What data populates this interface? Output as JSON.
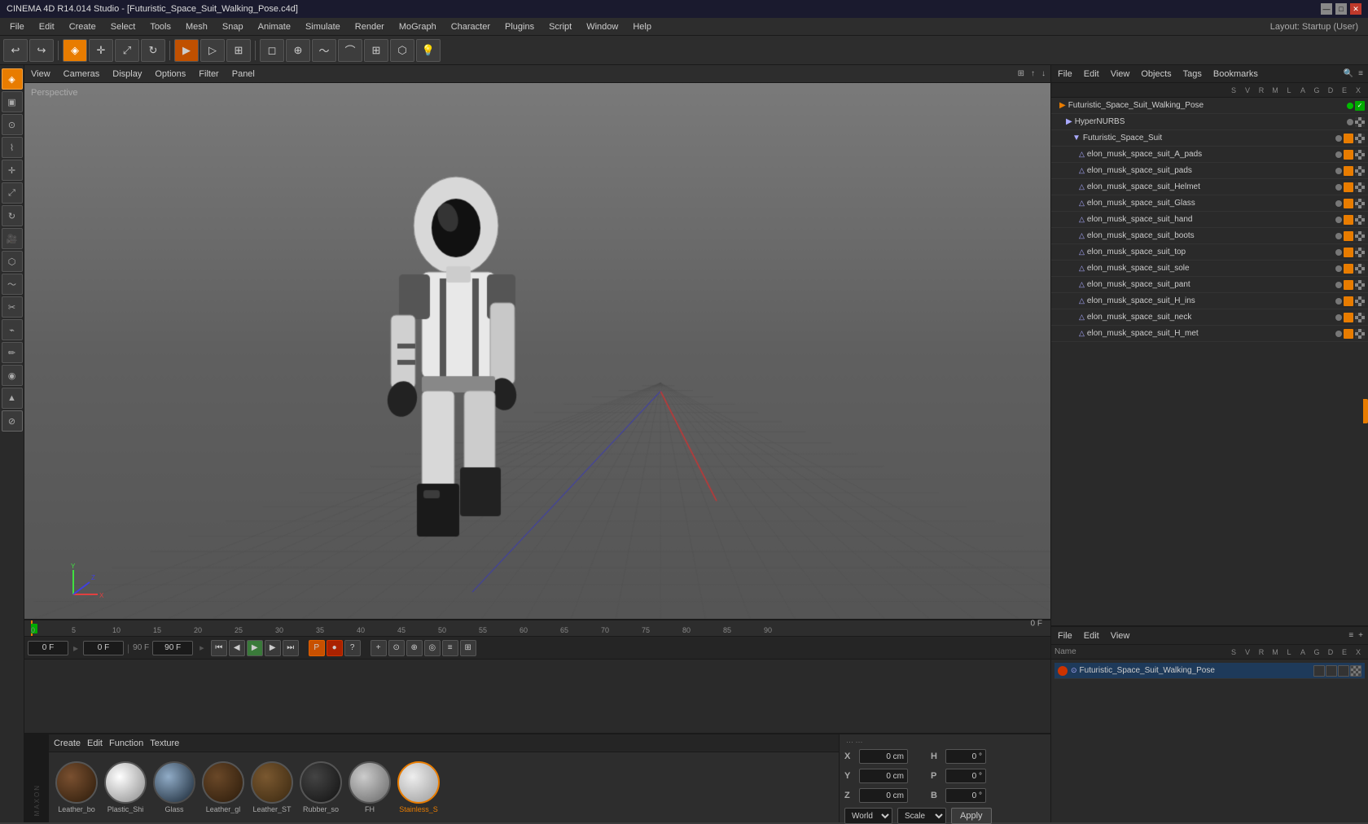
{
  "titleBar": {
    "title": "CINEMA 4D R14.014 Studio - [Futuristic_Space_Suit_Walking_Pose.c4d]",
    "minBtn": "—",
    "maxBtn": "□",
    "closeBtn": "✕"
  },
  "menuBar": {
    "items": [
      "File",
      "Edit",
      "Create",
      "Select",
      "Tools",
      "Mesh",
      "Snap",
      "Animate",
      "Simulate",
      "Render",
      "MoGraph",
      "Character",
      "Plugins",
      "Script",
      "Window",
      "Help"
    ],
    "layoutLabel": "Layout: Startup (User)"
  },
  "viewport": {
    "label": "Perspective",
    "viewMenu": [
      "View",
      "Cameras",
      "Display",
      "Options",
      "Filter",
      "Panel"
    ]
  },
  "objectManager": {
    "topMenus": [
      "File",
      "Edit",
      "View",
      "Objects",
      "Tags",
      "Bookmarks"
    ],
    "topObject": "Futuristic_Space_Suit_Walking_Pose",
    "objects": [
      {
        "name": "HyperNURBS",
        "indent": 1,
        "type": "nurbs"
      },
      {
        "name": "Futuristic_Space_Suit",
        "indent": 2,
        "type": "null"
      },
      {
        "name": "elon_musk_space_suit_A_pads",
        "indent": 3,
        "type": "poly"
      },
      {
        "name": "elon_musk_space_suit_pads",
        "indent": 3,
        "type": "poly"
      },
      {
        "name": "elon_musk_space_suit_Helmet",
        "indent": 3,
        "type": "poly"
      },
      {
        "name": "elon_musk_space_suit_Glass",
        "indent": 3,
        "type": "poly"
      },
      {
        "name": "elon_musk_space_suit_hand",
        "indent": 3,
        "type": "poly"
      },
      {
        "name": "elon_musk_space_suit_boots",
        "indent": 3,
        "type": "poly"
      },
      {
        "name": "elon_musk_space_suit_top",
        "indent": 3,
        "type": "poly"
      },
      {
        "name": "elon_musk_space_suit_sole",
        "indent": 3,
        "type": "poly"
      },
      {
        "name": "elon_musk_space_suit_pant",
        "indent": 3,
        "type": "poly"
      },
      {
        "name": "elon_musk_space_suit_H_ins",
        "indent": 3,
        "type": "poly"
      },
      {
        "name": "elon_musk_space_suit_neck",
        "indent": 3,
        "type": "poly"
      },
      {
        "name": "elon_musk_space_suit_H_met",
        "indent": 3,
        "type": "poly"
      }
    ],
    "bottomMenus": [
      "File",
      "Edit",
      "View"
    ],
    "bottomObject": "Futuristic_Space_Suit_Walking_Pose",
    "colHeaders": [
      "S",
      "V",
      "R",
      "M",
      "L",
      "A",
      "G",
      "D",
      "E",
      "X"
    ]
  },
  "timeline": {
    "startFrame": "0 F",
    "endFrame": "90 F",
    "currentFrame": "0 F",
    "currentFrameInput": "0 F",
    "frameRangeEnd": "90 F",
    "ticks": [
      "0",
      "5",
      "10",
      "15",
      "20",
      "25",
      "30",
      "35",
      "40",
      "45",
      "50",
      "55",
      "60",
      "65",
      "70",
      "75",
      "80",
      "85",
      "90"
    ],
    "frameEnd": "0 F"
  },
  "materials": {
    "menuItems": [
      "Create",
      "Edit",
      "Function",
      "Texture"
    ],
    "items": [
      {
        "name": "Leather_bo",
        "color": "#4a3020",
        "highlight": "#8a6040"
      },
      {
        "name": "Plastic_Shi",
        "color": "#cccccc",
        "highlight": "#ffffff"
      },
      {
        "name": "Glass",
        "color": "#223344",
        "highlight": "#88ccff"
      },
      {
        "name": "Leather_gl",
        "color": "#3a2a18",
        "highlight": "#7a5a38"
      },
      {
        "name": "Leather_ST",
        "color": "#4a3820",
        "highlight": "#8a6840"
      },
      {
        "name": "Rubber_so",
        "color": "#222222",
        "highlight": "#555555"
      },
      {
        "name": "FH",
        "color": "#888888",
        "highlight": "#cccccc"
      },
      {
        "name": "Stainless_S",
        "color": "#bbbbbb",
        "highlight": "#eeeeee",
        "selected": true
      }
    ]
  },
  "coordinates": {
    "x": {
      "label": "X",
      "value": "0 cm"
    },
    "y": {
      "label": "Y",
      "value": "0 cm"
    },
    "z": {
      "label": "Z",
      "value": "0 cm"
    },
    "h": {
      "label": "H",
      "value": "0 °"
    },
    "p": {
      "label": "P",
      "value": "0 °"
    },
    "b": {
      "label": "B",
      "value": "0 °"
    },
    "mode": "World",
    "transform": "Scale",
    "applyBtn": "Apply"
  },
  "toolbarIcons": {
    "undo": "↩",
    "redo": "↪",
    "live": "◉",
    "mode1": "●",
    "mode2": "○",
    "mode3": "◎",
    "move": "✛",
    "rotate": "↻",
    "scale": "⤢",
    "render": "▶",
    "renderView": "▷",
    "renderAll": "⊞"
  },
  "leftToolbar": {
    "tools": [
      {
        "name": "select-live",
        "icon": "◈",
        "active": true
      },
      {
        "name": "select-rect",
        "icon": "▣"
      },
      {
        "name": "select-circle",
        "icon": "⊙"
      },
      {
        "name": "select-lasso",
        "icon": "⌇"
      },
      {
        "name": "move-tool",
        "icon": "✛"
      },
      {
        "name": "scale-tool",
        "icon": "⤢"
      },
      {
        "name": "rotate-tool",
        "icon": "↻"
      },
      {
        "name": "camera-tool",
        "icon": "📷"
      },
      {
        "name": "polygon-tool",
        "icon": "⬡"
      },
      {
        "name": "spline-tool",
        "icon": "～"
      },
      {
        "name": "knife-tool",
        "icon": "✂"
      },
      {
        "name": "weld-tool",
        "icon": "◉"
      },
      {
        "name": "brush-tool",
        "icon": "🖌"
      },
      {
        "name": "magnet-tool",
        "icon": "⌁"
      },
      {
        "name": "bend-tool",
        "icon": "⌒"
      },
      {
        "name": "paint-tool",
        "icon": "▲"
      }
    ]
  }
}
